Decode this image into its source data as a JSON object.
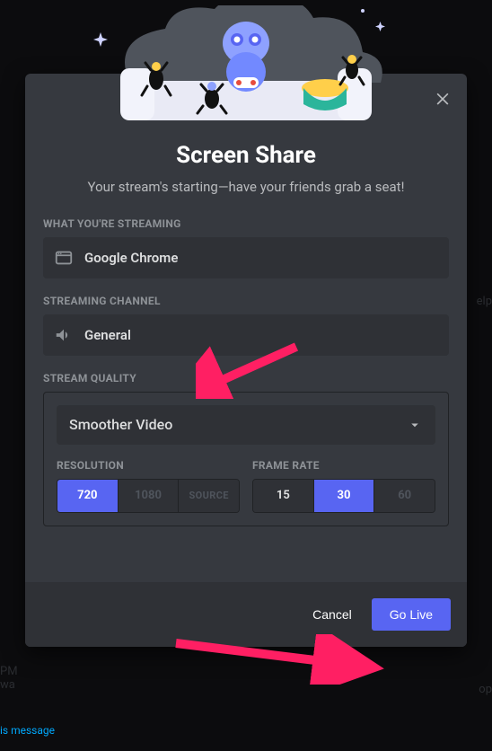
{
  "modal": {
    "title": "Screen Share",
    "subtitle": "Your stream's starting—have your friends grab a seat!",
    "close_label": "Close"
  },
  "streaming": {
    "section_label": "WHAT YOU'RE STREAMING",
    "app_name": "Google Chrome"
  },
  "channel": {
    "section_label": "STREAMING CHANNEL",
    "name": "General"
  },
  "quality": {
    "section_label": "STREAM QUALITY",
    "preset_selected": "Smoother Video",
    "resolution": {
      "label": "RESOLUTION",
      "options": [
        "720",
        "1080",
        "SOURCE"
      ],
      "selected": "720",
      "disabled": [
        "1080",
        "SOURCE"
      ]
    },
    "framerate": {
      "label": "FRAME RATE",
      "options": [
        "15",
        "30",
        "60"
      ],
      "selected": "30",
      "disabled": [
        "60"
      ]
    }
  },
  "footer": {
    "cancel_label": "Cancel",
    "go_live_label": "Go Live"
  },
  "colors": {
    "accent": "#5865f2"
  }
}
